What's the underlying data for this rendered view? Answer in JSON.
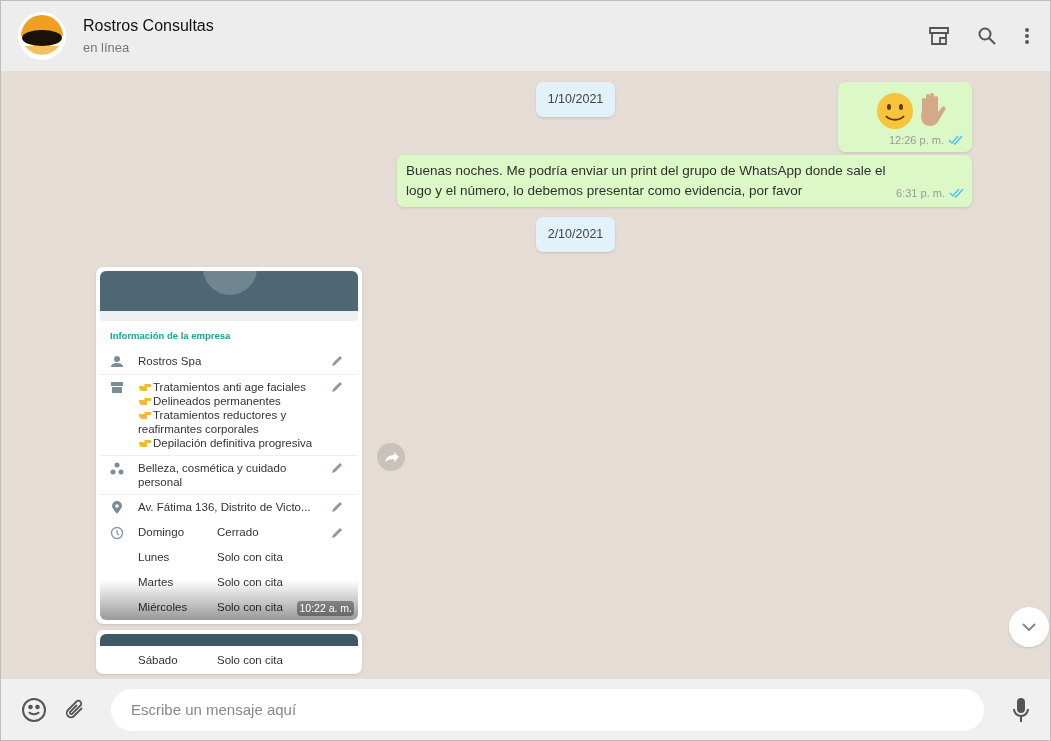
{
  "header": {
    "title": "Rostros Consultas",
    "subtitle": "en línea"
  },
  "messages": [
    {
      "kind": "date",
      "text": "1/10/2021"
    },
    {
      "kind": "emoji",
      "time": "12:26 p. m.",
      "read": true
    },
    {
      "kind": "text",
      "text": "Buenas noches. Me podría enviar un print del grupo de WhatsApp donde sale el logo y el número, lo debemos presentar como evidencia, por favor",
      "time": "6:31 p. m.",
      "read": true
    },
    {
      "kind": "date",
      "text": "2/10/2021"
    },
    {
      "kind": "image",
      "time": "10:22 a. m.",
      "section_title": "Información de la empresa",
      "rows": [
        {
          "kind": "person",
          "lines": [
            "Rostros Spa"
          ]
        },
        {
          "kind": "store",
          "lines": [
            "Tratamientos anti age faciales",
            "Delineados permanentes",
            "Tratamientos reductores y reafirmantes corporales",
            "Depilación definitiva progresiva"
          ]
        },
        {
          "kind": "category",
          "lines": [
            "Belleza, cosmética y cuidado personal"
          ]
        },
        {
          "kind": "location",
          "lines": [
            "Av. Fátima 136, Distrito de Victo..."
          ]
        }
      ],
      "hours": [
        {
          "day": "Domingo",
          "status": "Cerrado"
        },
        {
          "day": "Lunes",
          "status": "Solo con cita"
        },
        {
          "day": "Martes",
          "status": "Solo con cita"
        },
        {
          "day": "Miércoles",
          "status": "Solo con cita"
        }
      ]
    },
    {
      "kind": "image_partial",
      "hours": [
        {
          "day": "Sábado",
          "status": "Solo con cita"
        }
      ]
    }
  ],
  "composer": {
    "placeholder": "Escribe un mensaje aquí"
  }
}
